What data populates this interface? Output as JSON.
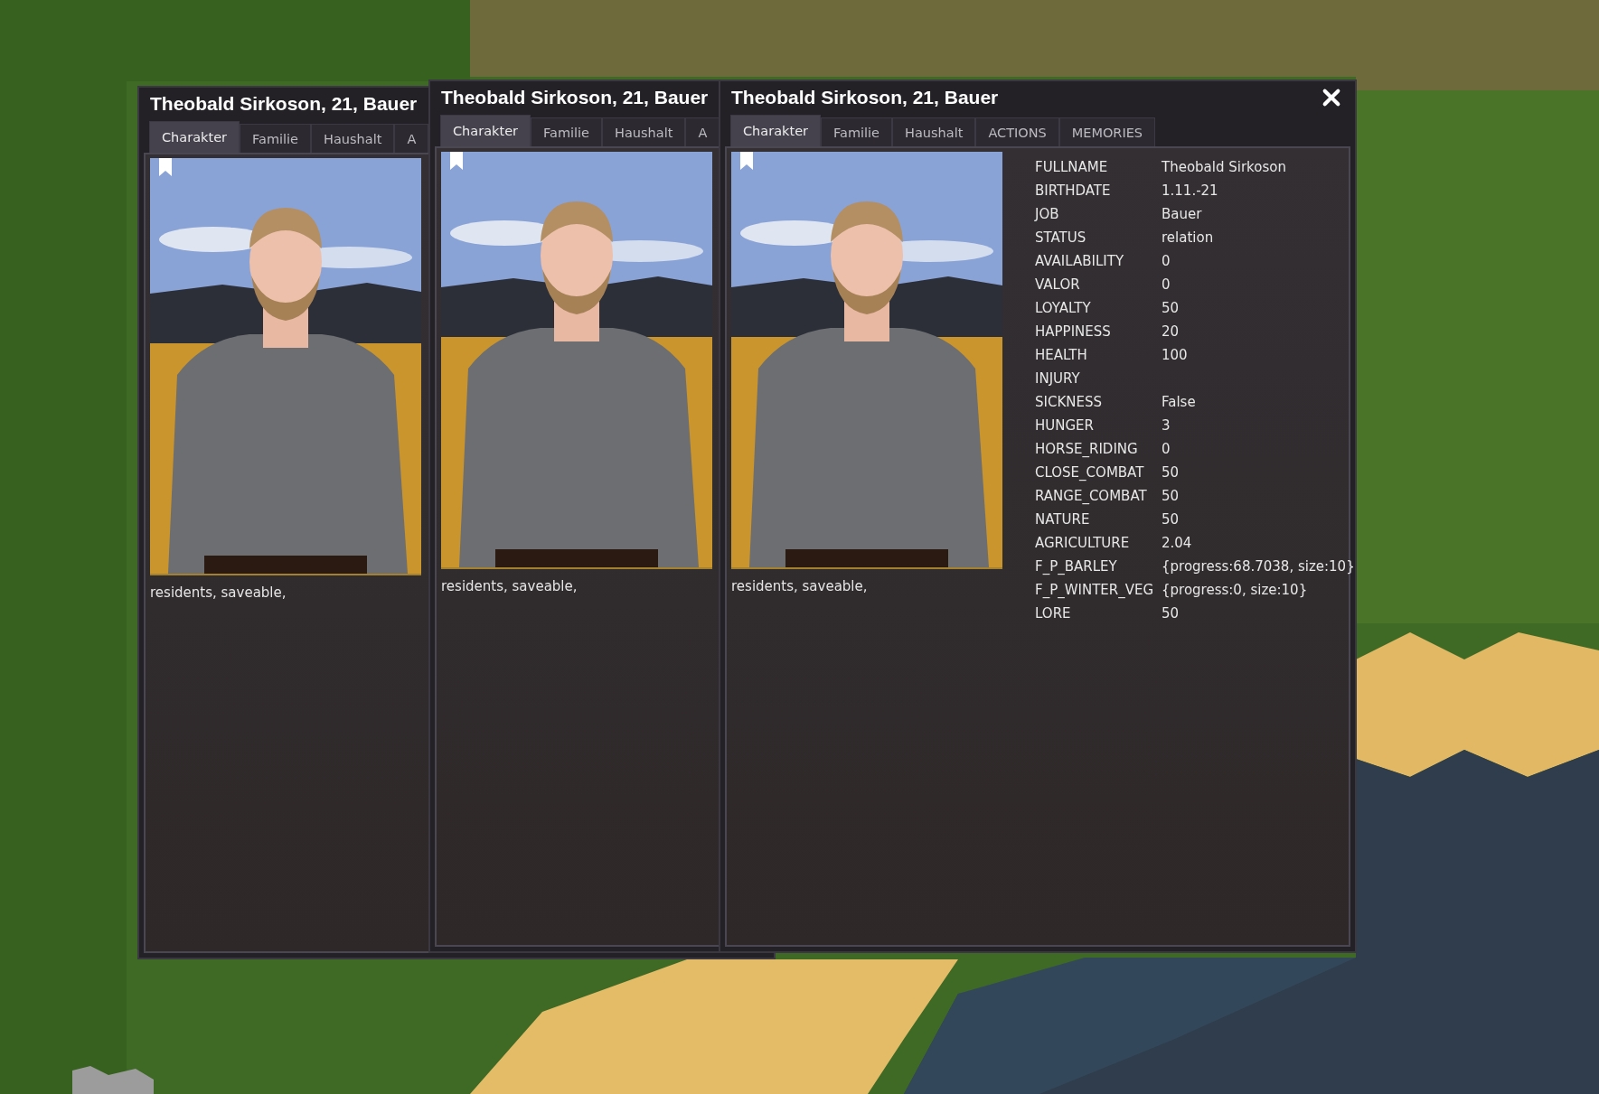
{
  "windows": [
    {
      "title": "Theobald Sirkoson, 21, Bauer",
      "tabs": [
        {
          "label": "Charakter",
          "selected": true
        },
        {
          "label": "Familie",
          "selected": false
        },
        {
          "label": "Haushalt",
          "selected": false
        },
        {
          "label": "A",
          "selected": false
        }
      ],
      "tags": "residents, saveable,"
    },
    {
      "title": "Theobald Sirkoson, 21, Bauer",
      "tabs": [
        {
          "label": "Charakter",
          "selected": true
        },
        {
          "label": "Familie",
          "selected": false
        },
        {
          "label": "Haushalt",
          "selected": false
        },
        {
          "label": "A",
          "selected": false
        }
      ],
      "tags": "residents, saveable,"
    },
    {
      "title": "Theobald Sirkoson, 21, Bauer",
      "closable": true,
      "tabs": [
        {
          "label": "Charakter",
          "selected": true
        },
        {
          "label": "Familie",
          "selected": false
        },
        {
          "label": "Haushalt",
          "selected": false
        },
        {
          "label": "ACTIONS",
          "selected": false
        },
        {
          "label": "MEMORIES",
          "selected": false
        }
      ],
      "tags": "residents, saveable,",
      "stats": [
        {
          "label": "FULLNAME",
          "value": "Theobald Sirkoson"
        },
        {
          "label": "BIRTHDATE",
          "value": "1.11.-21"
        },
        {
          "label": "JOB",
          "value": "Bauer"
        },
        {
          "label": "STATUS",
          "value": "relation"
        },
        {
          "label": "AVAILABILITY",
          "value": "0"
        },
        {
          "label": "VALOR",
          "value": "0"
        },
        {
          "label": "LOYALTY",
          "value": "50"
        },
        {
          "label": "HAPPINESS",
          "value": "20"
        },
        {
          "label": "HEALTH",
          "value": "100"
        },
        {
          "label": "INJURY"
        },
        {
          "label": "SICKNESS",
          "value": "False"
        },
        {
          "label": "HUNGER",
          "value": "3"
        },
        {
          "label": "HORSE_RIDING",
          "value": "0"
        },
        {
          "label": "CLOSE_COMBAT",
          "value": "50"
        },
        {
          "label": "RANGE_COMBAT",
          "value": "50"
        },
        {
          "label": "NATURE",
          "value": "50"
        },
        {
          "label": "AGRICULTURE",
          "value": "2.04"
        },
        {
          "label": "F_P_BARLEY",
          "value": "{progress:68.7038, size:10}"
        },
        {
          "label": "F_P_WINTER_VEG",
          "value": "{progress:0, size:10}"
        },
        {
          "label": "LORE",
          "value": "50"
        }
      ]
    }
  ]
}
